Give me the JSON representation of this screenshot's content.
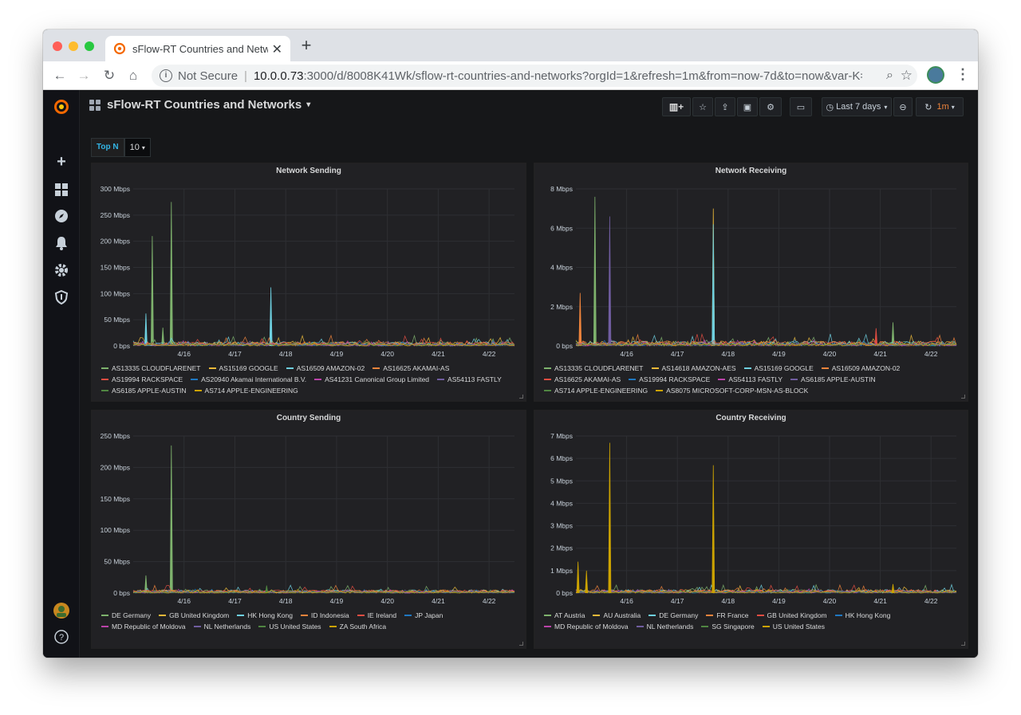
{
  "browser": {
    "tab_title": "sFlow-RT Countries and Networ",
    "security_label": "Not Secure",
    "url_host": "10.0.0.73",
    "url_path": ":3000/d/8008K41Wk/sflow-rt-countries-and-networks?orgId=1&refresh=1m&from=now-7d&to=now&var-K=..."
  },
  "dashboard": {
    "title": "sFlow-RT Countries and Networks",
    "time_range": "Last 7 days",
    "refresh": "1m",
    "variable_label": "Top N",
    "variable_value": "10"
  },
  "colors": {
    "green": "#7eb26d",
    "yellow": "#eab839",
    "cyan": "#6ed0e0",
    "orange": "#ef843c",
    "red": "#e24d42",
    "blue": "#1f78c1",
    "pink": "#ba43a9",
    "purple": "#705da0",
    "darkgreen": "#508642",
    "gold": "#cca300"
  },
  "icons": {
    "sidebar": [
      "grafana-logo-icon",
      "plus-icon",
      "dashboards-icon",
      "explore-icon",
      "alerting-icon",
      "gear-icon",
      "shield-icon",
      "user-avatar-icon",
      "help-icon"
    ],
    "toolbar": [
      "add-panel-icon",
      "star-icon",
      "share-icon",
      "save-icon",
      "settings-icon",
      "tv-mode-icon",
      "clock-icon",
      "zoom-out-icon",
      "refresh-icon"
    ]
  },
  "chart_data": [
    {
      "type": "line",
      "title": "Network Sending",
      "x_ticks": [
        "4/16",
        "4/17",
        "4/18",
        "4/19",
        "4/20",
        "4/21",
        "4/22"
      ],
      "y_ticks": [
        "0 bps",
        "50 Mbps",
        "100 Mbps",
        "150 Mbps",
        "200 Mbps",
        "250 Mbps",
        "300 Mbps"
      ],
      "ylim": [
        0,
        300
      ],
      "y_unit": "Mbps",
      "grid": true,
      "legend_position": "bottom",
      "series": [
        {
          "name": "AS13335 CLOUDFLARENET",
          "color": "#7eb26d",
          "spikes": [
            [
              "04-15 09:00",
              210
            ],
            [
              "04-15 18:00",
              275
            ],
            [
              "04-15 14:00",
              35
            ]
          ]
        },
        {
          "name": "AS15169 GOOGLE",
          "color": "#eab839",
          "spikes": []
        },
        {
          "name": "AS16509 AMAZON-02",
          "color": "#6ed0e0",
          "spikes": [
            [
              "04-15 06:00",
              62
            ],
            [
              "04-17 17:00",
              112
            ]
          ]
        },
        {
          "name": "AS16625 AKAMAI-AS",
          "color": "#ef843c",
          "spikes": []
        },
        {
          "name": "AS19994 RACKSPACE",
          "color": "#e24d42",
          "spikes": []
        },
        {
          "name": "AS20940 Akamai International B.V.",
          "color": "#1f78c1",
          "spikes": []
        },
        {
          "name": "AS41231 Canonical Group Limited",
          "color": "#ba43a9",
          "spikes": []
        },
        {
          "name": "AS54113 FASTLY",
          "color": "#705da0",
          "spikes": []
        },
        {
          "name": "AS6185 APPLE-AUSTIN",
          "color": "#508642",
          "spikes": []
        },
        {
          "name": "AS714 APPLE-ENGINEERING",
          "color": "#cca300",
          "spikes": []
        }
      ],
      "noise_level": 8
    },
    {
      "type": "line",
      "title": "Network Receiving",
      "x_ticks": [
        "4/16",
        "4/17",
        "4/18",
        "4/19",
        "4/20",
        "4/21",
        "4/22"
      ],
      "y_ticks": [
        "0 bps",
        "2 Mbps",
        "4 Mbps",
        "6 Mbps",
        "8 Mbps"
      ],
      "ylim": [
        0,
        8
      ],
      "y_unit": "Mbps",
      "grid": true,
      "legend_position": "bottom",
      "series": [
        {
          "name": "AS13335 CLOUDFLARENET",
          "color": "#7eb26d",
          "spikes": [
            [
              "04-15 09:00",
              7.6
            ],
            [
              "04-21 06:00",
              1.2
            ]
          ]
        },
        {
          "name": "AS14618 AMAZON-AES",
          "color": "#eab839",
          "spikes": [
            [
              "04-17 17:00",
              7.0
            ]
          ]
        },
        {
          "name": "AS15169 GOOGLE",
          "color": "#6ed0e0",
          "spikes": [
            [
              "04-17 17:00",
              6.2
            ]
          ]
        },
        {
          "name": "AS16509 AMAZON-02",
          "color": "#ef843c",
          "spikes": [
            [
              "04-15 02:00",
              2.7
            ]
          ]
        },
        {
          "name": "AS16625 AKAMAI-AS",
          "color": "#e24d42",
          "spikes": [
            [
              "04-20 22:00",
              0.9
            ]
          ]
        },
        {
          "name": "AS19994 RACKSPACE",
          "color": "#1f78c1",
          "spikes": []
        },
        {
          "name": "AS54113 FASTLY",
          "color": "#ba43a9",
          "spikes": []
        },
        {
          "name": "AS6185 APPLE-AUSTIN",
          "color": "#705da0",
          "spikes": [
            [
              "04-15 16:00",
              6.6
            ]
          ]
        },
        {
          "name": "AS714 APPLE-ENGINEERING",
          "color": "#508642",
          "spikes": []
        },
        {
          "name": "AS8075 MICROSOFT-CORP-MSN-AS-BLOCK",
          "color": "#cca300",
          "spikes": []
        }
      ],
      "noise_level": 0.25
    },
    {
      "type": "line",
      "title": "Country Sending",
      "x_ticks": [
        "4/16",
        "4/17",
        "4/18",
        "4/19",
        "4/20",
        "4/21",
        "4/22"
      ],
      "y_ticks": [
        "0 bps",
        "50 Mbps",
        "100 Mbps",
        "150 Mbps",
        "200 Mbps",
        "250 Mbps"
      ],
      "ylim": [
        0,
        250
      ],
      "y_unit": "Mbps",
      "grid": true,
      "legend_position": "bottom",
      "series": [
        {
          "name": "DE Germany",
          "color": "#7eb26d",
          "spikes": [
            [
              "04-15 18:00",
              235
            ],
            [
              "04-15 06:00",
              28
            ]
          ]
        },
        {
          "name": "GB United Kingdom",
          "color": "#eab839",
          "spikes": []
        },
        {
          "name": "HK Hong Kong",
          "color": "#6ed0e0",
          "spikes": []
        },
        {
          "name": "ID Indonesia",
          "color": "#ef843c",
          "spikes": []
        },
        {
          "name": "IE Ireland",
          "color": "#e24d42",
          "spikes": []
        },
        {
          "name": "JP Japan",
          "color": "#1f78c1",
          "spikes": []
        },
        {
          "name": "MD Republic of Moldova",
          "color": "#ba43a9",
          "spikes": []
        },
        {
          "name": "NL Netherlands",
          "color": "#705da0",
          "spikes": []
        },
        {
          "name": "US United States",
          "color": "#508642",
          "spikes": [
            [
              "04-17 15:00",
              12
            ]
          ]
        },
        {
          "name": "ZA South Africa",
          "color": "#cca300",
          "spikes": []
        }
      ],
      "noise_level": 5
    },
    {
      "type": "line",
      "title": "Country Receiving",
      "x_ticks": [
        "4/16",
        "4/17",
        "4/18",
        "4/19",
        "4/20",
        "4/21",
        "4/22"
      ],
      "y_ticks": [
        "0 bps",
        "1 Mbps",
        "2 Mbps",
        "3 Mbps",
        "4 Mbps",
        "5 Mbps",
        "6 Mbps",
        "7 Mbps"
      ],
      "ylim": [
        0,
        7
      ],
      "y_unit": "Mbps",
      "grid": true,
      "legend_position": "bottom",
      "series": [
        {
          "name": "AT Austria",
          "color": "#7eb26d",
          "spikes": []
        },
        {
          "name": "AU Australia",
          "color": "#eab839",
          "spikes": []
        },
        {
          "name": "DE Germany",
          "color": "#6ed0e0",
          "spikes": []
        },
        {
          "name": "FR France",
          "color": "#ef843c",
          "spikes": []
        },
        {
          "name": "GB United Kingdom",
          "color": "#e24d42",
          "spikes": []
        },
        {
          "name": "HK Hong Kong",
          "color": "#1f78c1",
          "spikes": []
        },
        {
          "name": "MD Republic of Moldova",
          "color": "#ba43a9",
          "spikes": []
        },
        {
          "name": "NL Netherlands",
          "color": "#705da0",
          "spikes": []
        },
        {
          "name": "SG Singapore",
          "color": "#508642",
          "spikes": []
        },
        {
          "name": "US United States",
          "color": "#cca300",
          "spikes": [
            [
              "04-15 01:00",
              1.4
            ],
            [
              "04-15 05:00",
              1.0
            ],
            [
              "04-15 16:00",
              6.7
            ],
            [
              "04-17 17:00",
              5.7
            ],
            [
              "04-21 06:00",
              0.4
            ]
          ]
        }
      ],
      "noise_level": 0.15
    }
  ]
}
